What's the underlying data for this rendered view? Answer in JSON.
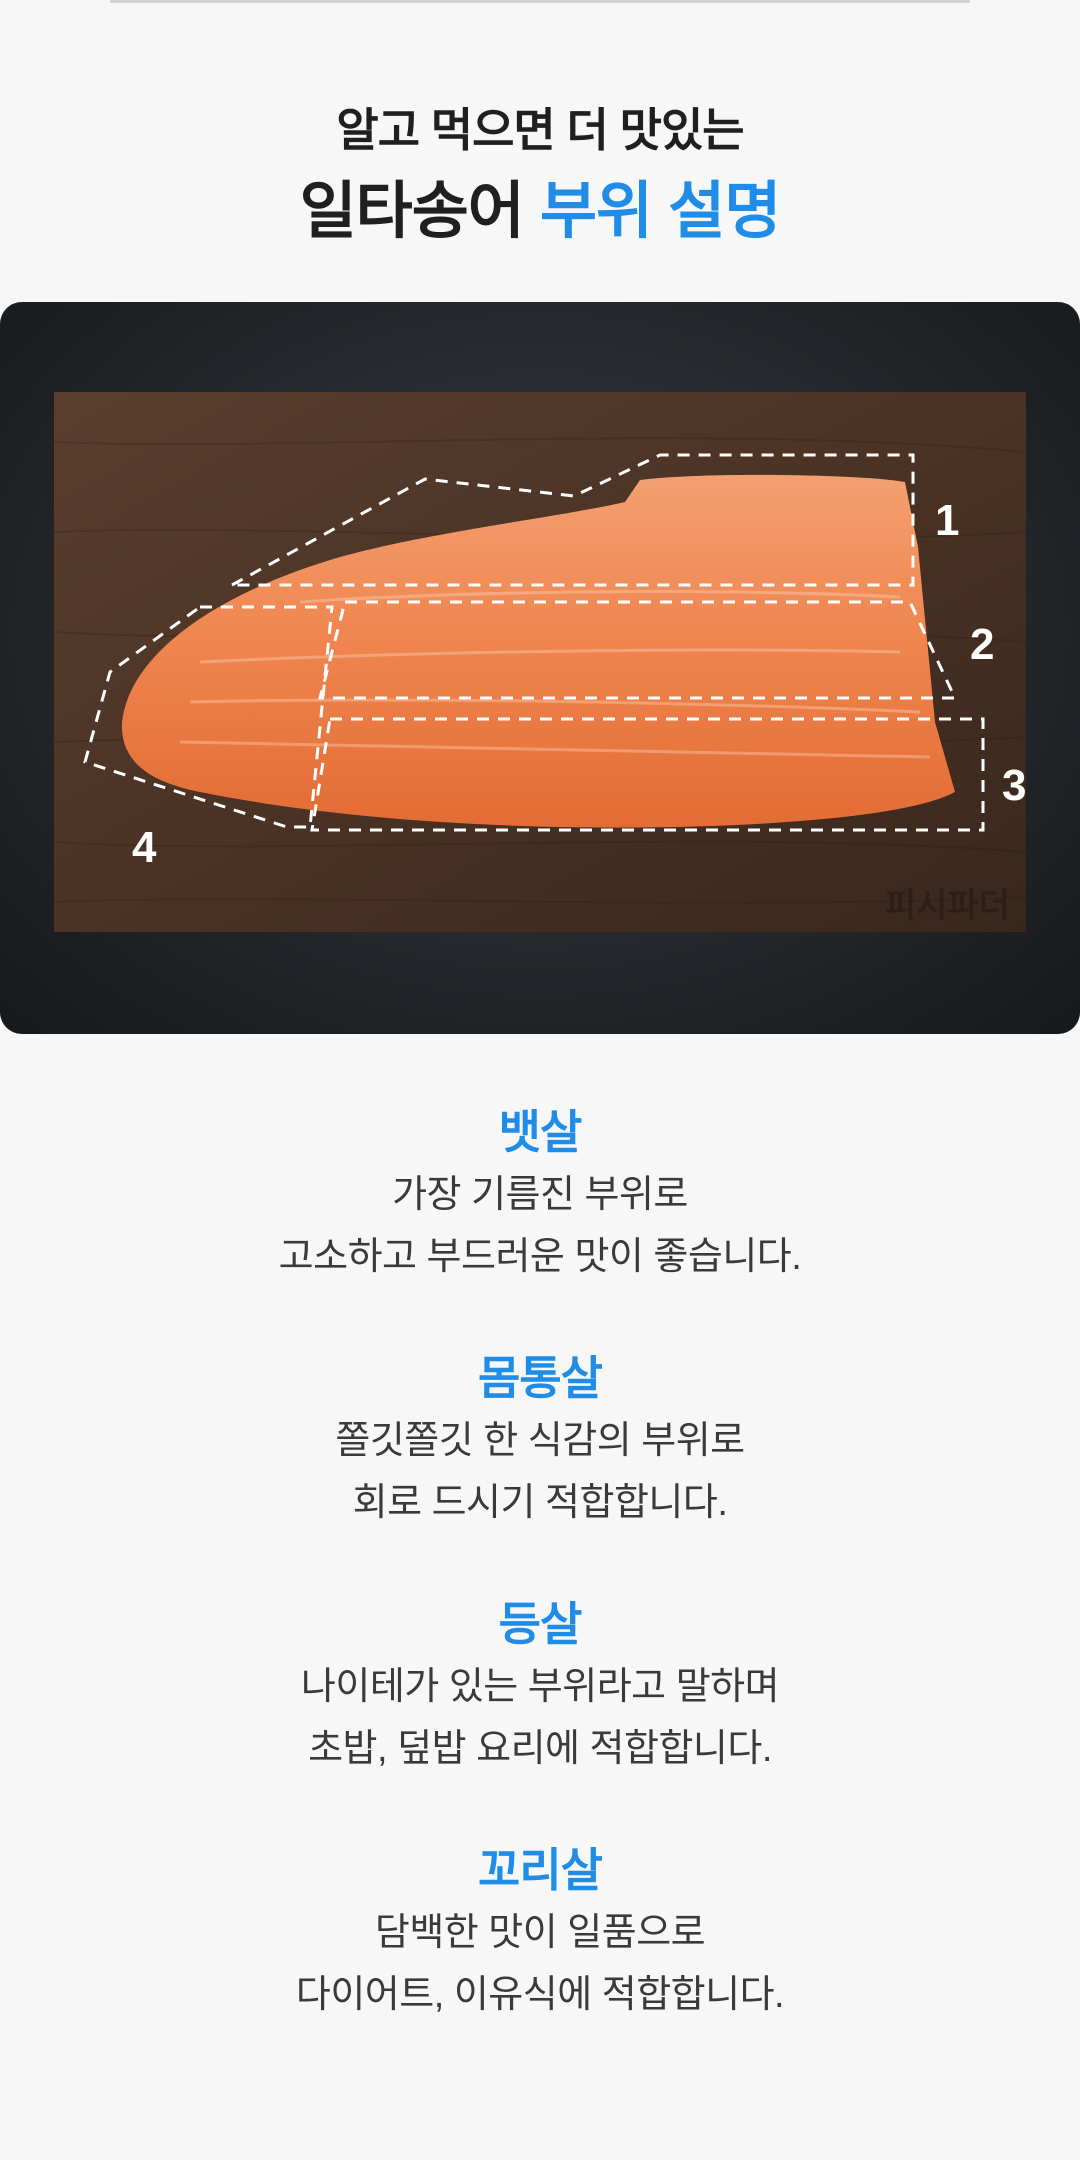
{
  "heading": {
    "sub": "알고 먹으면 더 맛있는",
    "main_prefix": "일타송어 ",
    "main_accent": "부위 설명"
  },
  "photo": {
    "markers": [
      "1",
      "2",
      "3",
      "4"
    ],
    "watermark": "피시파더"
  },
  "parts": [
    {
      "title": "뱃살",
      "line1": "가장 기름진 부위로",
      "line2": "고소하고 부드러운 맛이 좋습니다."
    },
    {
      "title": "몸통살",
      "line1": "쫄깃쫄깃 한 식감의 부위로",
      "line2": "회로 드시기 적합합니다."
    },
    {
      "title": "등살",
      "line1": "나이테가 있는 부위라고 말하며",
      "line2": "초밥, 덮밥 요리에 적합합니다."
    },
    {
      "title": "꼬리살",
      "line1": "담백한 맛이 일품으로",
      "line2": "다이어트, 이유식에 적합합니다."
    }
  ],
  "colors": {
    "accent": "#1f8ce8",
    "text": "#1f1f1f",
    "body_text": "#3a3a3a",
    "background": "#f7f7f7"
  }
}
